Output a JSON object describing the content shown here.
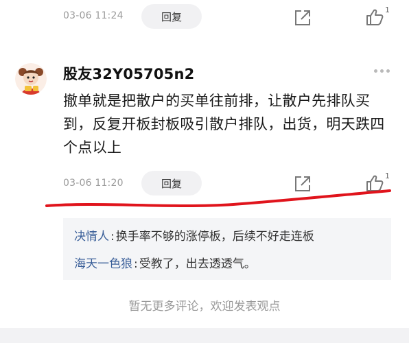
{
  "prev_comment": {
    "time": "03-06 11:24",
    "reply_label": "回复",
    "like_count": "1"
  },
  "comment": {
    "username": "股友32Y05705n2",
    "text": "撤单就是把散户的买单往前排，让散户先排队买到，反复开板封板吸引散户排队，出货，明天跌四个点以上",
    "time": "03-06 11:20",
    "reply_label": "回复",
    "like_count": "1",
    "replies": [
      {
        "author": "决情人",
        "sep": ":",
        "text": "换手率不够的涨停板，后续不好走连板"
      },
      {
        "author": "海天一色狼",
        "sep": ":",
        "text": "受教了，出去透透气。"
      }
    ]
  },
  "footer_text": "暂无更多评论，欢迎发表观点",
  "icons": {
    "share": "share-icon",
    "like": "thumbs-up-icon",
    "more": "more-dots-icon"
  },
  "colors": {
    "annotation": "#e0141c",
    "reply_author": "#3a5f99"
  }
}
